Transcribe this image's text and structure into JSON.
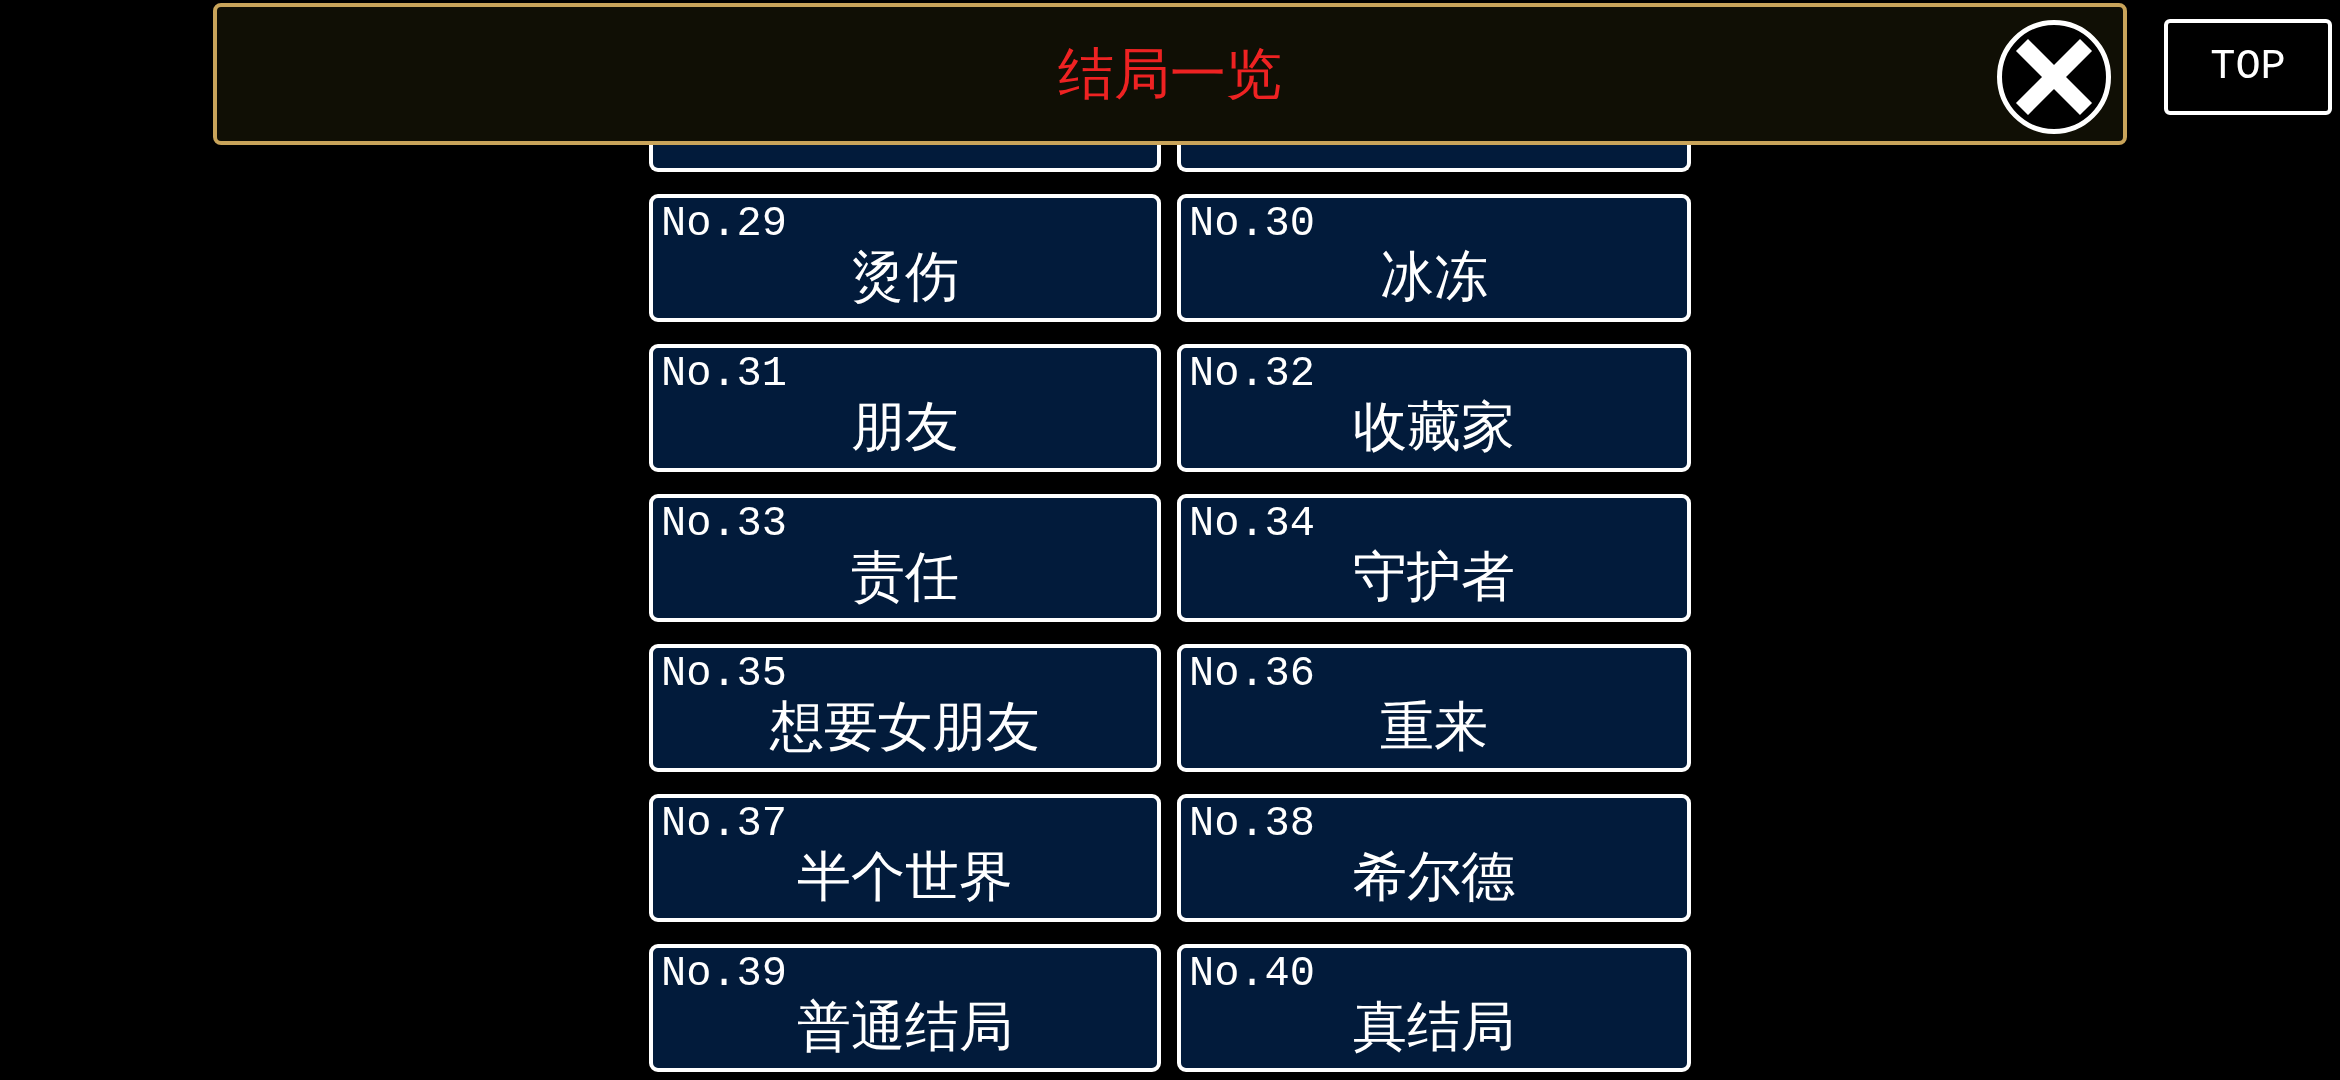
{
  "header": {
    "title": "结局一览"
  },
  "top_button": {
    "label": "TOP"
  },
  "endings": [
    {
      "kind": "cut"
    },
    {
      "kind": "cut"
    },
    {
      "kind": "full",
      "number": "No.29",
      "title": "烫伤"
    },
    {
      "kind": "full",
      "number": "No.30",
      "title": "冰冻"
    },
    {
      "kind": "full",
      "number": "No.31",
      "title": "朋友"
    },
    {
      "kind": "full",
      "number": "No.32",
      "title": "收藏家"
    },
    {
      "kind": "full",
      "number": "No.33",
      "title": "责任"
    },
    {
      "kind": "full",
      "number": "No.34",
      "title": "守护者"
    },
    {
      "kind": "full",
      "number": "No.35",
      "title": "想要女朋友"
    },
    {
      "kind": "full",
      "number": "No.36",
      "title": "重来"
    },
    {
      "kind": "full",
      "number": "No.37",
      "title": "半个世界"
    },
    {
      "kind": "full",
      "number": "No.38",
      "title": "希尔德"
    },
    {
      "kind": "full",
      "number": "No.39",
      "title": "普通结局"
    },
    {
      "kind": "full",
      "number": "No.40",
      "title": "真结局"
    }
  ]
}
